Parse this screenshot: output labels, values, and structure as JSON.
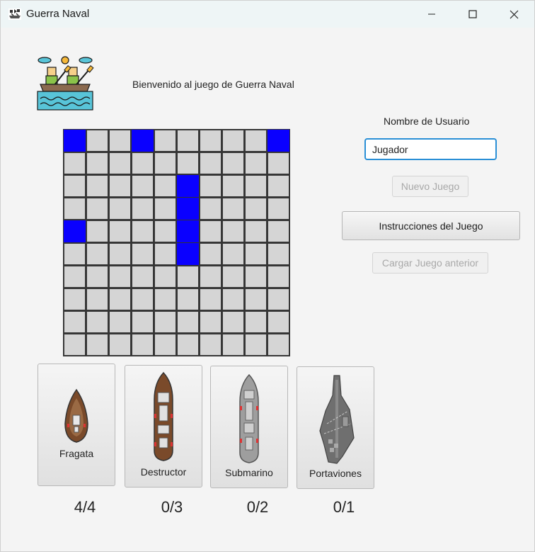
{
  "window": {
    "title": "Guerra Naval",
    "icon": "battleship-app-icon",
    "controls": [
      "minimize-icon",
      "maximize-icon",
      "close-icon"
    ]
  },
  "header": {
    "logo": "rowing-boat-logo",
    "welcome_text": "Bienvenido al juego de Guerra Naval"
  },
  "board": {
    "rows": 10,
    "cols": 10,
    "ship_color": "#0a00ff",
    "empty_color": "#d5d5d5",
    "ship_cells": [
      [
        0,
        0
      ],
      [
        0,
        3
      ],
      [
        0,
        9
      ],
      [
        2,
        5
      ],
      [
        3,
        5
      ],
      [
        4,
        0
      ],
      [
        4,
        5
      ],
      [
        5,
        5
      ]
    ]
  },
  "sidebar": {
    "user_label": "Nombre de Usuario",
    "user_value": "Jugador",
    "new_game_label": "Nuevo Juego",
    "instructions_label": "Instrucciones del Juego",
    "load_game_label": "Cargar Juego anterior"
  },
  "ships": [
    {
      "name": "Fragata",
      "icon": "frigate-icon",
      "count": "4/4"
    },
    {
      "name": "Destructor",
      "icon": "destroyer-icon",
      "count": "0/3"
    },
    {
      "name": "Submarino",
      "icon": "submarine-icon",
      "count": "0/2"
    },
    {
      "name": "Portaviones",
      "icon": "aircraft-carrier-icon",
      "count": "0/1"
    }
  ]
}
